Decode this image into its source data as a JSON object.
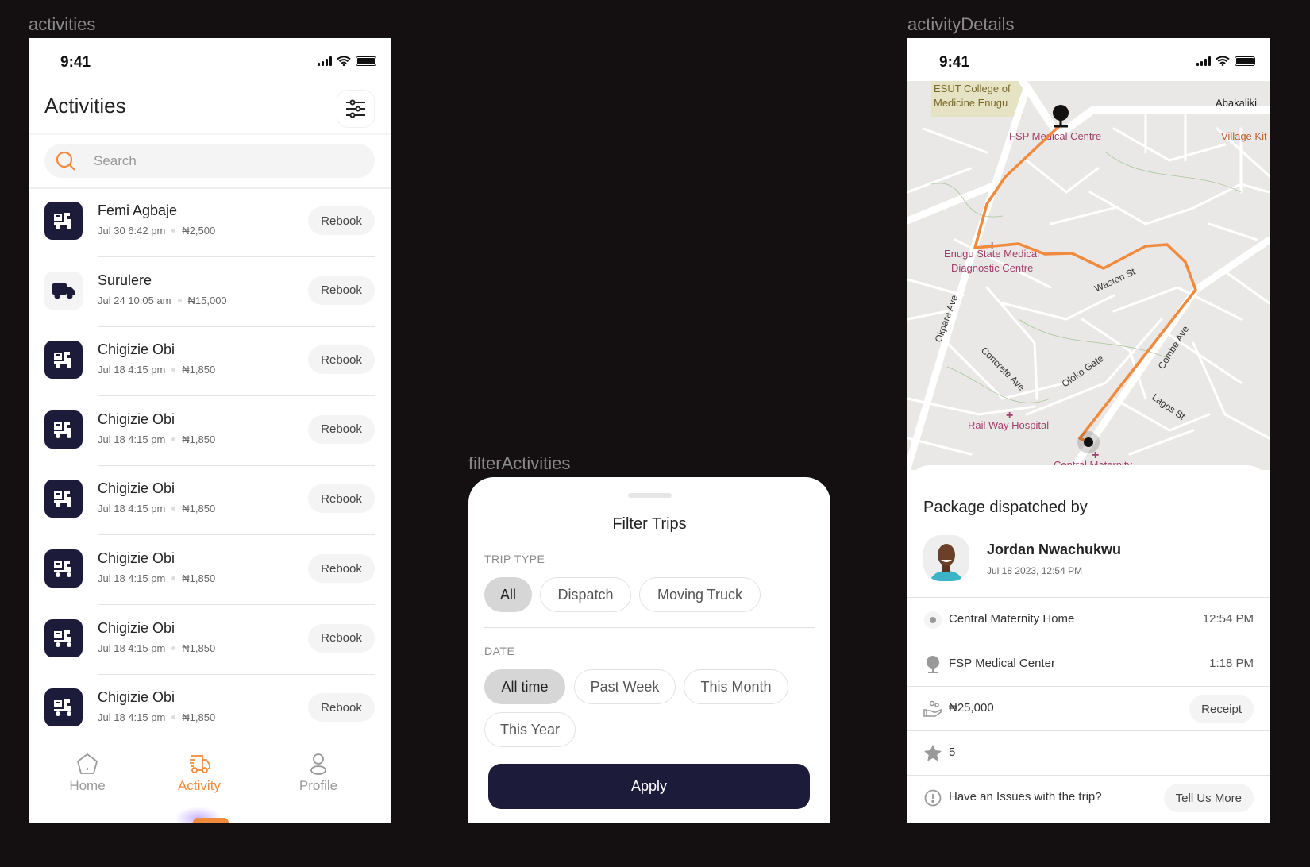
{
  "frames": {
    "activities": "activities",
    "filter": "filterActivities",
    "details": "activityDetails"
  },
  "status": {
    "time": "9:41"
  },
  "colors": {
    "accent": "#f08a3c",
    "navy": "#1c1c3a",
    "chip_selected": "#d6d6d6"
  },
  "activities": {
    "title": "Activities",
    "filter_icon": "sliders-icon",
    "search_placeholder": "Search",
    "items": [
      {
        "name": "Femi Agbaje",
        "date": "Jul 30 6:42 pm",
        "amount": "₦2,500",
        "icon": "dispatch-bike-icon",
        "button": "Rebook"
      },
      {
        "name": "Surulere",
        "date": "Jul 24 10:05 am",
        "amount": "₦15,000",
        "icon": "truck-icon",
        "button": "Rebook"
      },
      {
        "name": "Chigizie Obi",
        "date": "Jul 18 4:15 pm",
        "amount": "₦1,850",
        "icon": "dispatch-bike-icon",
        "button": "Rebook"
      },
      {
        "name": "Chigizie Obi",
        "date": "Jul 18 4:15 pm",
        "amount": "₦1,850",
        "icon": "dispatch-bike-icon",
        "button": "Rebook"
      },
      {
        "name": "Chigizie Obi",
        "date": "Jul 18 4:15 pm",
        "amount": "₦1,850",
        "icon": "dispatch-bike-icon",
        "button": "Rebook"
      },
      {
        "name": "Chigizie Obi",
        "date": "Jul 18 4:15 pm",
        "amount": "₦1,850",
        "icon": "dispatch-bike-icon",
        "button": "Rebook"
      },
      {
        "name": "Chigizie Obi",
        "date": "Jul 18 4:15 pm",
        "amount": "₦1,850",
        "icon": "dispatch-bike-icon",
        "button": "Rebook"
      },
      {
        "name": "Chigizie Obi",
        "date": "Jul 18 4:15 pm",
        "amount": "₦1,850",
        "icon": "dispatch-bike-icon",
        "button": "Rebook"
      }
    ],
    "nav": [
      {
        "label": "Home",
        "icon": "home-icon",
        "active": false
      },
      {
        "label": "Activity",
        "icon": "delivery-truck-icon",
        "active": true
      },
      {
        "label": "Profile",
        "icon": "user-icon",
        "active": false
      }
    ]
  },
  "filter": {
    "title": "Filter Trips",
    "trip_type_label": "TRIP TYPE",
    "trip_types": [
      {
        "label": "All",
        "selected": true
      },
      {
        "label": "Dispatch",
        "selected": false
      },
      {
        "label": "Moving Truck",
        "selected": false
      }
    ],
    "date_label": "DATE",
    "dates": [
      {
        "label": "All time",
        "selected": true
      },
      {
        "label": "Past Week",
        "selected": false
      },
      {
        "label": "This Month",
        "selected": false
      },
      {
        "label": "This Year",
        "selected": false
      }
    ],
    "apply": "Apply"
  },
  "details": {
    "map_labels": {
      "esut1": "ESUT College of",
      "esut2": "Medicine Enugu",
      "fsp": "FSP Medical Centre",
      "abakaliki": "Abakaliki",
      "village": "Village Kit",
      "enugu1": "Enugu State Medical",
      "enugu2": "Diagnostic Centre",
      "waston": "Waston St",
      "okpara": "Okpara Ave",
      "concrete": "Concrete Ave",
      "oloko": "Oloko Gate",
      "combe": "Combe Ave",
      "lagos": "Lagos St",
      "railway": "Rail Way Hospital",
      "central": "Central Maternity"
    },
    "heading": "Package dispatched by",
    "driver": {
      "name": "Jordan Nwachukwu",
      "date": "Jul 18 2023, 12:54 PM"
    },
    "pickup": {
      "place": "Central Maternity Home",
      "time": "12:54 PM"
    },
    "dropoff": {
      "place": "FSP Medical Center",
      "time": "1:18 PM"
    },
    "price": {
      "amount": "₦25,000",
      "button": "Receipt"
    },
    "rating": "5",
    "issue": {
      "text": "Have an Issues with the trip?",
      "button": "Tell Us More"
    }
  }
}
